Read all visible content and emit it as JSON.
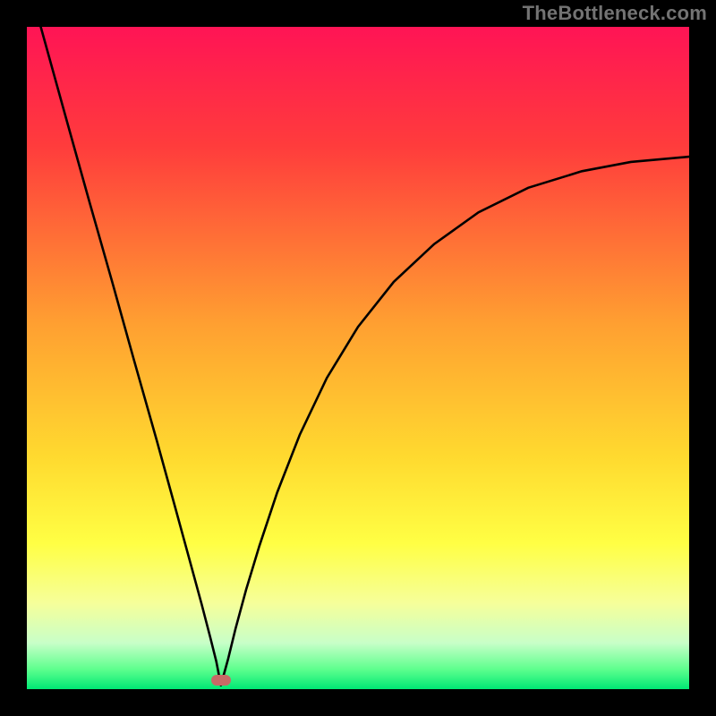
{
  "watermark": "TheBottleneck.com",
  "chart_data": {
    "type": "line",
    "title": "",
    "xlabel": "",
    "ylabel": "",
    "xlim": [
      0,
      100
    ],
    "ylim": [
      0,
      100
    ],
    "grid": false,
    "legend": false,
    "marker": {
      "x": 29.3,
      "y": 1.4,
      "color": "#c76a66"
    },
    "gradient_stops": [
      {
        "t": 0.0,
        "color": "#ff1455"
      },
      {
        "t": 0.18,
        "color": "#ff3c3c"
      },
      {
        "t": 0.45,
        "color": "#ffa031"
      },
      {
        "t": 0.65,
        "color": "#ffda2f"
      },
      {
        "t": 0.78,
        "color": "#ffff44"
      },
      {
        "t": 0.87,
        "color": "#f6ff9a"
      },
      {
        "t": 0.93,
        "color": "#c8ffc8"
      },
      {
        "t": 0.97,
        "color": "#5eff8e"
      },
      {
        "t": 1.0,
        "color": "#00e874"
      }
    ],
    "series": [
      {
        "name": "left-branch",
        "x": [
          2.1,
          6.2,
          9.5,
          12.8,
          16.2,
          19.6,
          22.3,
          24.3,
          26.4,
          27.7,
          28.6,
          29.3
        ],
        "y": [
          100.0,
          85.2,
          73.4,
          61.8,
          49.6,
          37.6,
          27.8,
          20.5,
          12.8,
          7.8,
          4.2,
          0.6
        ]
      },
      {
        "name": "right-branch",
        "x": [
          29.3,
          30.4,
          31.5,
          33.1,
          35.1,
          37.8,
          41.2,
          45.3,
          50.0,
          55.4,
          61.5,
          68.2,
          75.7,
          83.8,
          91.2,
          100.0
        ],
        "y": [
          0.6,
          4.6,
          9.1,
          15.0,
          21.6,
          29.7,
          38.4,
          47.0,
          54.7,
          61.5,
          67.2,
          72.0,
          75.7,
          78.2,
          79.6,
          80.4
        ]
      }
    ]
  }
}
